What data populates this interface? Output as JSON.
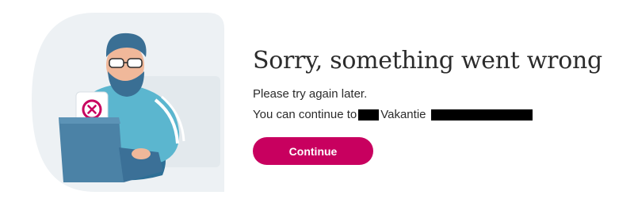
{
  "error": {
    "title": "Sorry, something went wrong",
    "message_line1": "Please try again later.",
    "message_line2_prefix": "You can continue to",
    "message_line2_mid": "Vakantie"
  },
  "actions": {
    "continue_label": "Continue"
  },
  "illustration": {
    "icon": "error-x-icon",
    "accent_color": "#c8005f"
  },
  "colors": {
    "button_bg": "#c8005f",
    "text": "#2b2b2b",
    "illustration_bg": "#eef2f4"
  }
}
